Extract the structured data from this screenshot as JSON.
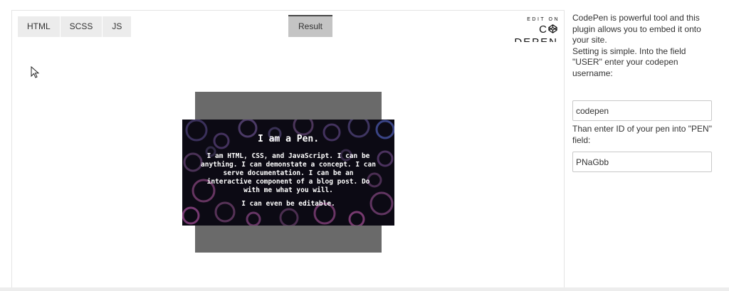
{
  "embed": {
    "tabs": [
      "HTML",
      "SCSS",
      "JS"
    ],
    "result_label": "Result",
    "brand": {
      "edit_on": "EDIT ON",
      "name": "C DEPEN"
    },
    "pen": {
      "title": "I am a Pen.",
      "text": "I am HTML, CSS, and JavaScript. I can be anything. I can demonstate a concept. I can serve documentation. I can be an interactive component of a blog post. Do with me what you will.",
      "text2": "I can even be editable."
    }
  },
  "sidebar": {
    "intro": "CodePen is powerful tool and this plugin allows you to embed it onto your site.",
    "setting": "Setting is simple. Into the field \"USER\" enter your codepen username:",
    "user_value": "codepen",
    "pen_help": "Than enter ID of your pen into \"PEN\" field:",
    "pen_value": "PNaGbb"
  },
  "colors": {
    "tab_bg": "#ececec",
    "result_tab_bg": "#c4c4c4",
    "pen_bg": "#0c0a14",
    "grey_box": "#6a6a6a"
  },
  "icons": {
    "cursor": "arrow-cursor-icon",
    "logo": "codepen-logo-icon"
  }
}
